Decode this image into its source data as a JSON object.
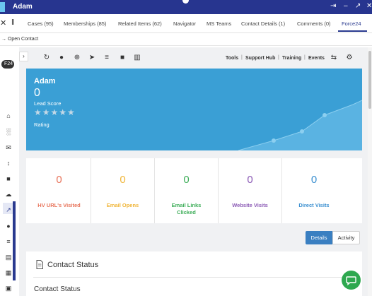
{
  "window": {
    "title": "Adam",
    "controls": [
      "pin-icon",
      "minimize-icon",
      "maximize-icon",
      "close-icon"
    ]
  },
  "tabs": [
    {
      "label": "Cases (95)",
      "active": false
    },
    {
      "label": "Memberships (85)",
      "active": false
    },
    {
      "label": "Related Items (62)",
      "active": false
    },
    {
      "label": "Navigator",
      "active": false
    },
    {
      "label": "MS Teams",
      "active": false
    },
    {
      "label": "Contact Details (1)",
      "active": false
    },
    {
      "label": "Comments (0)",
      "active": false
    },
    {
      "label": "Force24",
      "active": true
    }
  ],
  "subbar": {
    "open_contact_label": "Open Contact"
  },
  "leftrail": {
    "badge": "F24"
  },
  "toolbar": {
    "links": [
      "Tools",
      "Support Hub",
      "Training",
      "Events"
    ]
  },
  "hero": {
    "name": "Adam",
    "lead_score": "0",
    "lead_score_label": "Lead Score",
    "stars": "★★★★★",
    "rating_label": "Rating",
    "colors": {
      "background": "#3a9fd5"
    }
  },
  "stats": [
    {
      "value": "0",
      "label": "HV URL's Visited",
      "color": "#e8735a"
    },
    {
      "value": "0",
      "label": "Email Opens",
      "color": "#f0b63a"
    },
    {
      "value": "0",
      "label": "Email Links Clicked",
      "color": "#3fae5a"
    },
    {
      "value": "0",
      "label": "Website Visits",
      "color": "#8b5ab5"
    },
    {
      "value": "0",
      "label": "Direct Visits",
      "color": "#3a8fd0"
    }
  ],
  "view_toggle": {
    "details": "Details",
    "activity": "Activity",
    "selected": "Details"
  },
  "contact_status": {
    "card_title": "Contact Status",
    "section_title": "Contact Status"
  },
  "chat": {
    "icon": "chat-icon",
    "color": "#2ea84f"
  }
}
